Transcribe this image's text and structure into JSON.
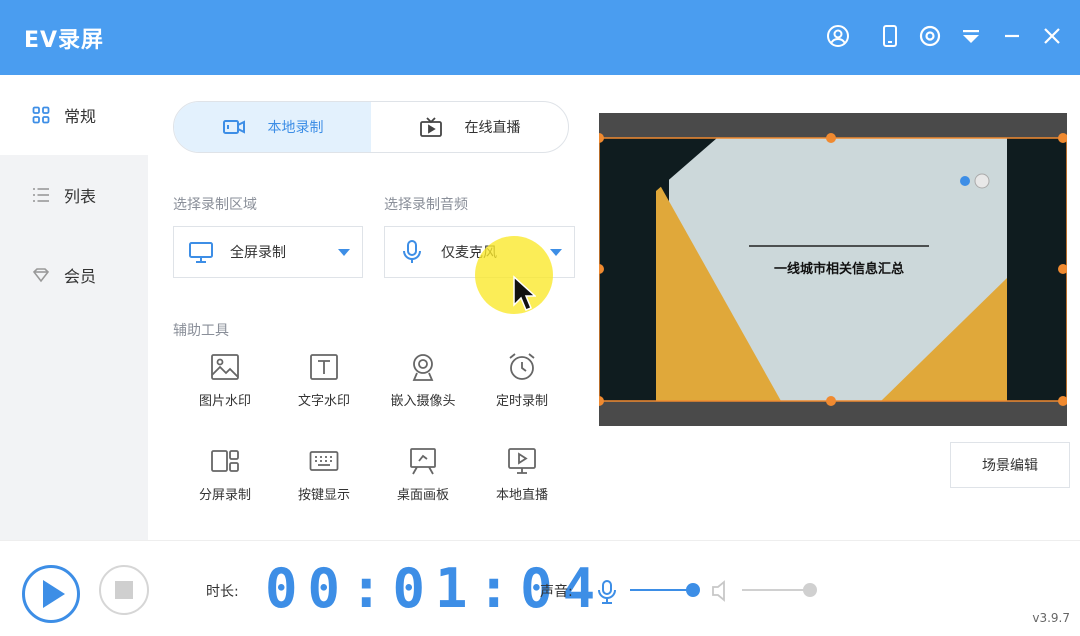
{
  "app": {
    "title": "EV录屏",
    "version": "v3.9.7"
  },
  "colors": {
    "accent": "#3d8ee6",
    "titlebar": "#4a9df0",
    "highlight": "#fae828"
  },
  "titlebar_icons": [
    "user-icon",
    "phone-icon",
    "settings-icon",
    "dropdown-icon",
    "minimize-icon",
    "close-icon"
  ],
  "sidebar": {
    "items": [
      {
        "label": "常规",
        "icon": "grid-icon",
        "active": true
      },
      {
        "label": "列表",
        "icon": "list-icon",
        "active": false
      },
      {
        "label": "会员",
        "icon": "diamond-icon",
        "active": false
      }
    ]
  },
  "mode_tabs": [
    {
      "label": "本地录制",
      "icon": "camera-icon",
      "active": true
    },
    {
      "label": "在线直播",
      "icon": "tv-icon",
      "active": false
    }
  ],
  "record_area": {
    "label": "选择录制区域",
    "value": "全屏录制",
    "icon": "monitor-icon"
  },
  "record_audio": {
    "label": "选择录制音频",
    "value": "仅麦克风",
    "icon": "mic-icon"
  },
  "tools": {
    "label": "辅助工具",
    "items": [
      {
        "label": "图片水印",
        "icon": "image-icon"
      },
      {
        "label": "文字水印",
        "icon": "text-icon"
      },
      {
        "label": "嵌入摄像头",
        "icon": "webcam-icon"
      },
      {
        "label": "定时录制",
        "icon": "alarm-icon"
      },
      {
        "label": "分屏录制",
        "icon": "split-screen-icon"
      },
      {
        "label": "按键显示",
        "icon": "keyboard-icon"
      },
      {
        "label": "桌面画板",
        "icon": "easel-icon"
      },
      {
        "label": "本地直播",
        "icon": "live-icon"
      }
    ]
  },
  "preview": {
    "slide_title": "一线城市相关信息汇总"
  },
  "scene_edit": {
    "label": "场景编辑"
  },
  "bottom": {
    "duration_label": "时长:",
    "duration": "00:01:04",
    "sound_label": "声音:",
    "mic_level": 0.95,
    "speaker_level": 1.0
  }
}
